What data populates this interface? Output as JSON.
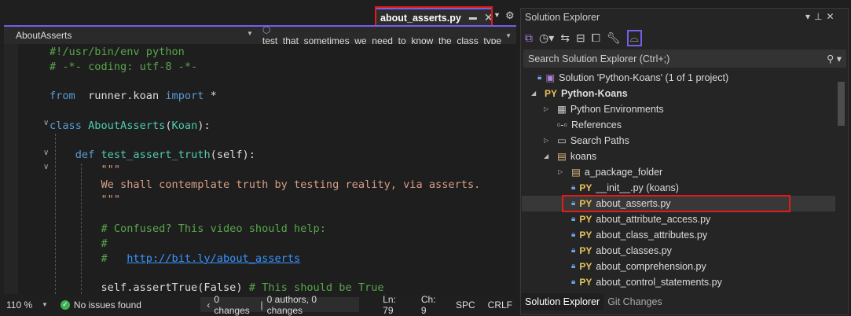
{
  "editor_tab": {
    "title": "about_asserts.py"
  },
  "navbar": {
    "class_dropdown": "AboutAsserts",
    "member_dropdown": "test_that_sometimes_we_need_to_know_the_class_type"
  },
  "code": [
    [
      [
        "cm",
        "#!/usr/bin/env python"
      ]
    ],
    [
      [
        "cm",
        "# -*- coding: utf-8 -*-"
      ]
    ],
    [],
    [
      [
        "kw",
        "from"
      ],
      [
        "",
        "  runner.koan "
      ],
      [
        "kw",
        "import"
      ],
      [
        "",
        " *"
      ]
    ],
    [],
    [
      [
        "kw",
        "class"
      ],
      [
        "",
        " "
      ],
      [
        "cls",
        "AboutAsserts"
      ],
      [
        "",
        "("
      ],
      [
        "cls",
        "Koan"
      ],
      [
        "",
        "):"
      ]
    ],
    [],
    [
      [
        "",
        "    "
      ],
      [
        "kw",
        "def"
      ],
      [
        "",
        " "
      ],
      [
        "fn",
        "test_assert_truth"
      ],
      [
        "",
        "(self):"
      ]
    ],
    [
      [
        "str",
        "        \"\"\""
      ]
    ],
    [
      [
        "str",
        "        We shall contemplate truth by testing reality, via asserts."
      ]
    ],
    [
      [
        "str",
        "        \"\"\""
      ]
    ],
    [],
    [
      [
        "cm",
        "        # Confused? This video should help:"
      ]
    ],
    [
      [
        "cm",
        "        #"
      ]
    ],
    [
      [
        "cm",
        "        #   "
      ],
      [
        "url",
        "http://bit.ly/about_asserts"
      ]
    ],
    [],
    [
      [
        "",
        "        self.assertTrue(False) "
      ],
      [
        "cm",
        "# This should be True"
      ]
    ]
  ],
  "status": {
    "zoom": "110 %",
    "issues": "No issues found",
    "changes": "0 changes",
    "authors": "0 authors, 0 changes",
    "line": "Ln: 79",
    "col": "Ch: 9",
    "whitespace": "SPC",
    "line_ending": "CRLF"
  },
  "solution_explorer": {
    "title": "Solution Explorer",
    "search_placeholder": "Search Solution Explorer (Ctrl+;)",
    "tree": [
      {
        "label": "Solution 'Python-Koans' (1 of 1 project)",
        "indent": 0,
        "icon": "solution-icon",
        "expander": ""
      },
      {
        "label": "Python-Koans",
        "indent": 1,
        "icon": "python-project-icon",
        "expander": "◢",
        "bold": true
      },
      {
        "label": "Python Environments",
        "indent": 2,
        "icon": "environments-icon",
        "expander": "▷"
      },
      {
        "label": "References",
        "indent": 2,
        "icon": "references-icon",
        "expander": ""
      },
      {
        "label": "Search Paths",
        "indent": 2,
        "icon": "search-paths-icon",
        "expander": "▷"
      },
      {
        "label": "koans",
        "indent": 2,
        "icon": "folder-icon",
        "expander": "◢"
      },
      {
        "label": "a_package_folder",
        "indent": 3,
        "icon": "package-folder-icon",
        "expander": "▷"
      },
      {
        "label": "__init__.py (koans)",
        "indent": 3,
        "icon": "python-file-icon",
        "expander": ""
      },
      {
        "label": "about_asserts.py",
        "indent": 3,
        "icon": "python-file-icon",
        "expander": "",
        "selected": true
      },
      {
        "label": "about_attribute_access.py",
        "indent": 3,
        "icon": "python-file-icon",
        "expander": ""
      },
      {
        "label": "about_class_attributes.py",
        "indent": 3,
        "icon": "python-file-icon",
        "expander": ""
      },
      {
        "label": "about_classes.py",
        "indent": 3,
        "icon": "python-file-icon",
        "expander": ""
      },
      {
        "label": "about_comprehension.py",
        "indent": 3,
        "icon": "python-file-icon",
        "expander": ""
      },
      {
        "label": "about_control_statements.py",
        "indent": 3,
        "icon": "python-file-icon",
        "expander": ""
      }
    ],
    "bottom_tabs": [
      "Solution Explorer",
      "Git Changes"
    ]
  },
  "colors": {
    "accent": "#7160e8",
    "highlight": "#e51a1a",
    "comment": "#57a64a",
    "keyword": "#569cd6",
    "type": "#4ec9b0",
    "string": "#d69d85"
  }
}
